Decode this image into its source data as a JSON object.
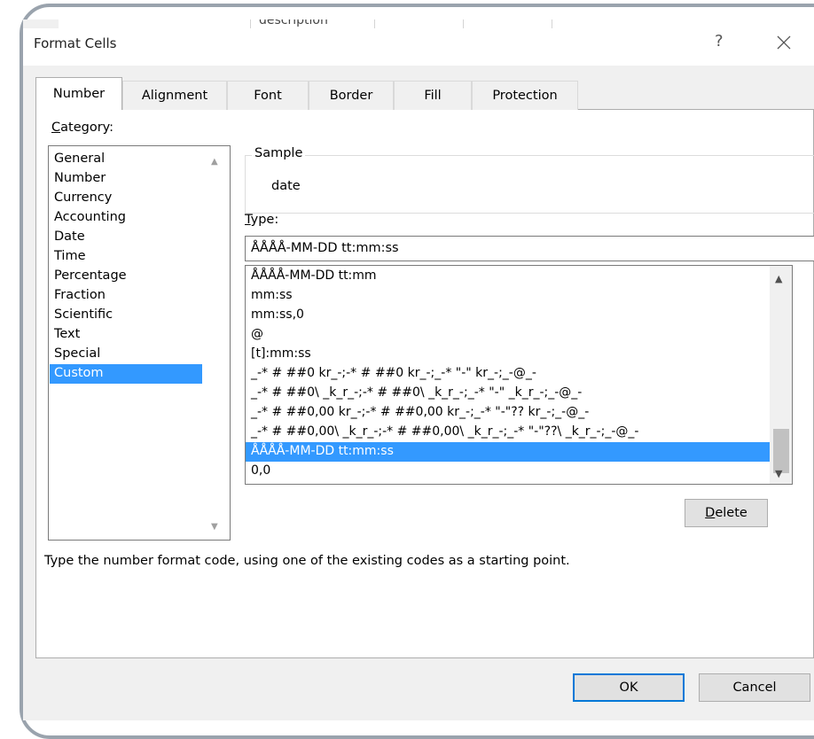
{
  "background_sheet": {
    "cell_text": "description"
  },
  "dialog": {
    "title": "Format Cells",
    "help_symbol": "?",
    "close_icon": "close-icon"
  },
  "tabs": [
    {
      "label": "Number",
      "active": true
    },
    {
      "label": "Alignment",
      "active": false
    },
    {
      "label": "Font",
      "active": false
    },
    {
      "label": "Border",
      "active": false
    },
    {
      "label": "Fill",
      "active": false
    },
    {
      "label": "Protection",
      "active": false
    }
  ],
  "category": {
    "label_first": "C",
    "label_rest": "ategory:",
    "items": [
      "General",
      "Number",
      "Currency",
      "Accounting",
      "Date",
      "Time",
      "Percentage",
      "Fraction",
      "Scientific",
      "Text",
      "Special",
      "Custom"
    ],
    "selected": "Custom"
  },
  "sample": {
    "legend": "Sample",
    "value": "date"
  },
  "type": {
    "label_first": "T",
    "label_rest": "ype:",
    "input_value": "ÅÅÅÅ-MM-DD tt:mm:ss",
    "list": [
      "ÅÅÅÅ-MM-DD tt:mm",
      "mm:ss",
      "mm:ss,0",
      "@",
      "[t]:mm:ss",
      "_-* # ##0 kr_-;-* # ##0 kr_-;_-* \"-\" kr_-;_-@_-",
      "_-* # ##0\\ _k_r_-;-* # ##0\\ _k_r_-;_-* \"-\" _k_r_-;_-@_-",
      "_-* # ##0,00 kr_-;-* # ##0,00 kr_-;_-* \"-\"?? kr_-;_-@_-",
      "_-* # ##0,00\\ _k_r_-;-* # ##0,00\\ _k_r_-;_-* \"-\"??\\ _k_r_-;_-@_-",
      "ÅÅÅÅ-MM-DD tt:mm:ss",
      "0,0"
    ],
    "selected_index": 9
  },
  "buttons": {
    "delete_first": "D",
    "delete_rest": "elete",
    "ok": "OK",
    "cancel": "Cancel"
  },
  "hint": "Type the number format code, using one of the existing codes as a starting point.",
  "colors": {
    "selection": "#3399ff",
    "default_button_border": "#0078d7"
  }
}
